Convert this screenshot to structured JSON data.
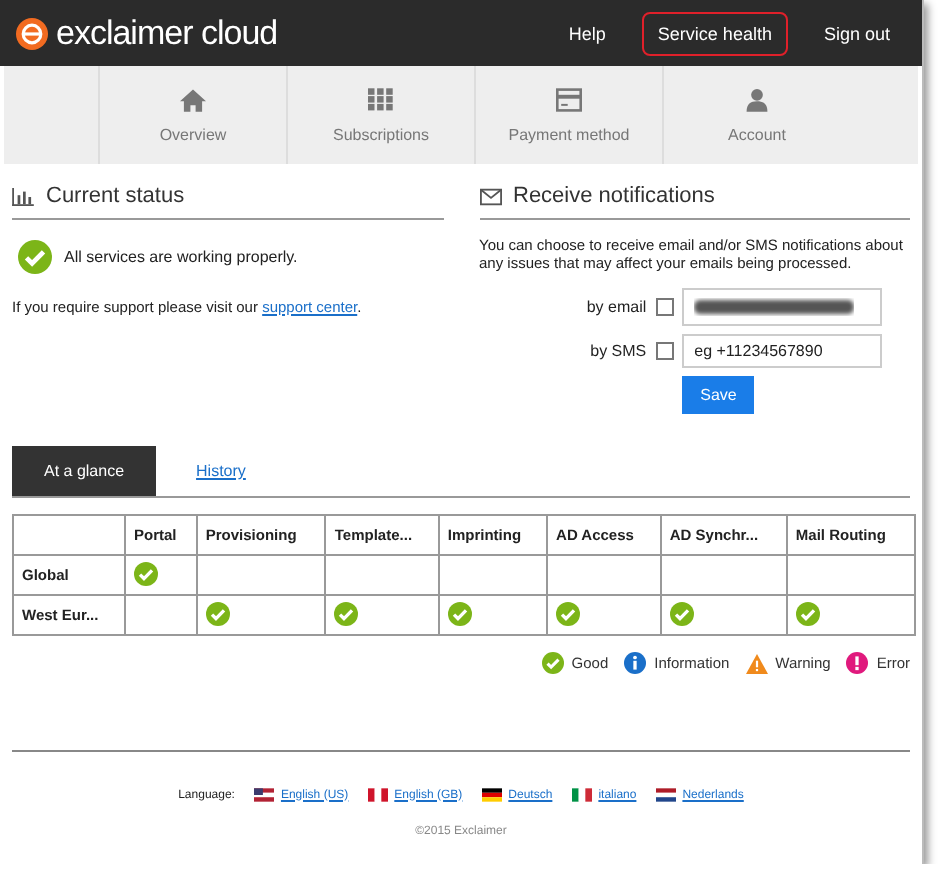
{
  "header": {
    "logo": "exclaimer",
    "logo_suffix": "cloud",
    "links": [
      {
        "label": "Help",
        "highlighted": false
      },
      {
        "label": "Service health",
        "highlighted": true
      },
      {
        "label": "Sign out",
        "highlighted": false
      }
    ]
  },
  "nav": [
    {
      "label": "Overview",
      "kind": "home"
    },
    {
      "label": "Subscriptions",
      "kind": "grid"
    },
    {
      "label": "Payment method",
      "kind": "card"
    },
    {
      "label": "Account",
      "kind": "user"
    }
  ],
  "current_status": {
    "title": "Current status",
    "message": "All services are working properly.",
    "support_text": "If you require support please visit our",
    "support_link": "support center",
    "support_end": "."
  },
  "notifications": {
    "title": "Receive notifications",
    "description": "You can choose to receive email and/or SMS notifications about any issues that may affect your emails being processed.",
    "fields": [
      {
        "label": "by email",
        "checked": false,
        "kind": "redacted"
      },
      {
        "label": "by SMS",
        "checked": false,
        "kind": "input",
        "placeholder": "eg +11234567890"
      }
    ],
    "button": "Save"
  },
  "tabs": [
    {
      "label": "At a glance",
      "selected": true
    },
    {
      "label": "History",
      "selected": false
    }
  ],
  "table": {
    "columns": [
      "Portal",
      "Provisioning",
      "Template...",
      "Imprinting",
      "AD Access",
      "AD Synchr...",
      "Mail Routing"
    ],
    "rows": [
      {
        "region": "Global",
        "statuses": [
          {
            "good": true
          },
          {
            "good": false
          },
          {
            "good": false
          },
          {
            "good": false
          },
          {
            "good": false
          },
          {
            "good": false
          },
          {
            "good": false
          }
        ]
      },
      {
        "region": "West Eur...",
        "statuses": [
          {
            "good": false
          },
          {
            "good": true
          },
          {
            "good": true
          },
          {
            "good": true
          },
          {
            "good": true
          },
          {
            "good": true
          },
          {
            "good": true
          }
        ]
      }
    ]
  },
  "legend": [
    {
      "label": "Good",
      "kind": "good"
    },
    {
      "label": "Information",
      "kind": "info"
    },
    {
      "label": "Warning",
      "kind": "warning"
    },
    {
      "label": "Error",
      "kind": "error"
    }
  ],
  "footer": {
    "language_label": "Language:",
    "languages": [
      {
        "label": "English (US)",
        "kind": "us"
      },
      {
        "label": "English (GB)",
        "kind": "gb"
      },
      {
        "label": "Deutsch",
        "kind": "de"
      },
      {
        "label": "italiano",
        "kind": "it"
      },
      {
        "label": "Nederlands",
        "kind": "nl"
      }
    ],
    "copyright": "©2015 Exclaimer"
  }
}
